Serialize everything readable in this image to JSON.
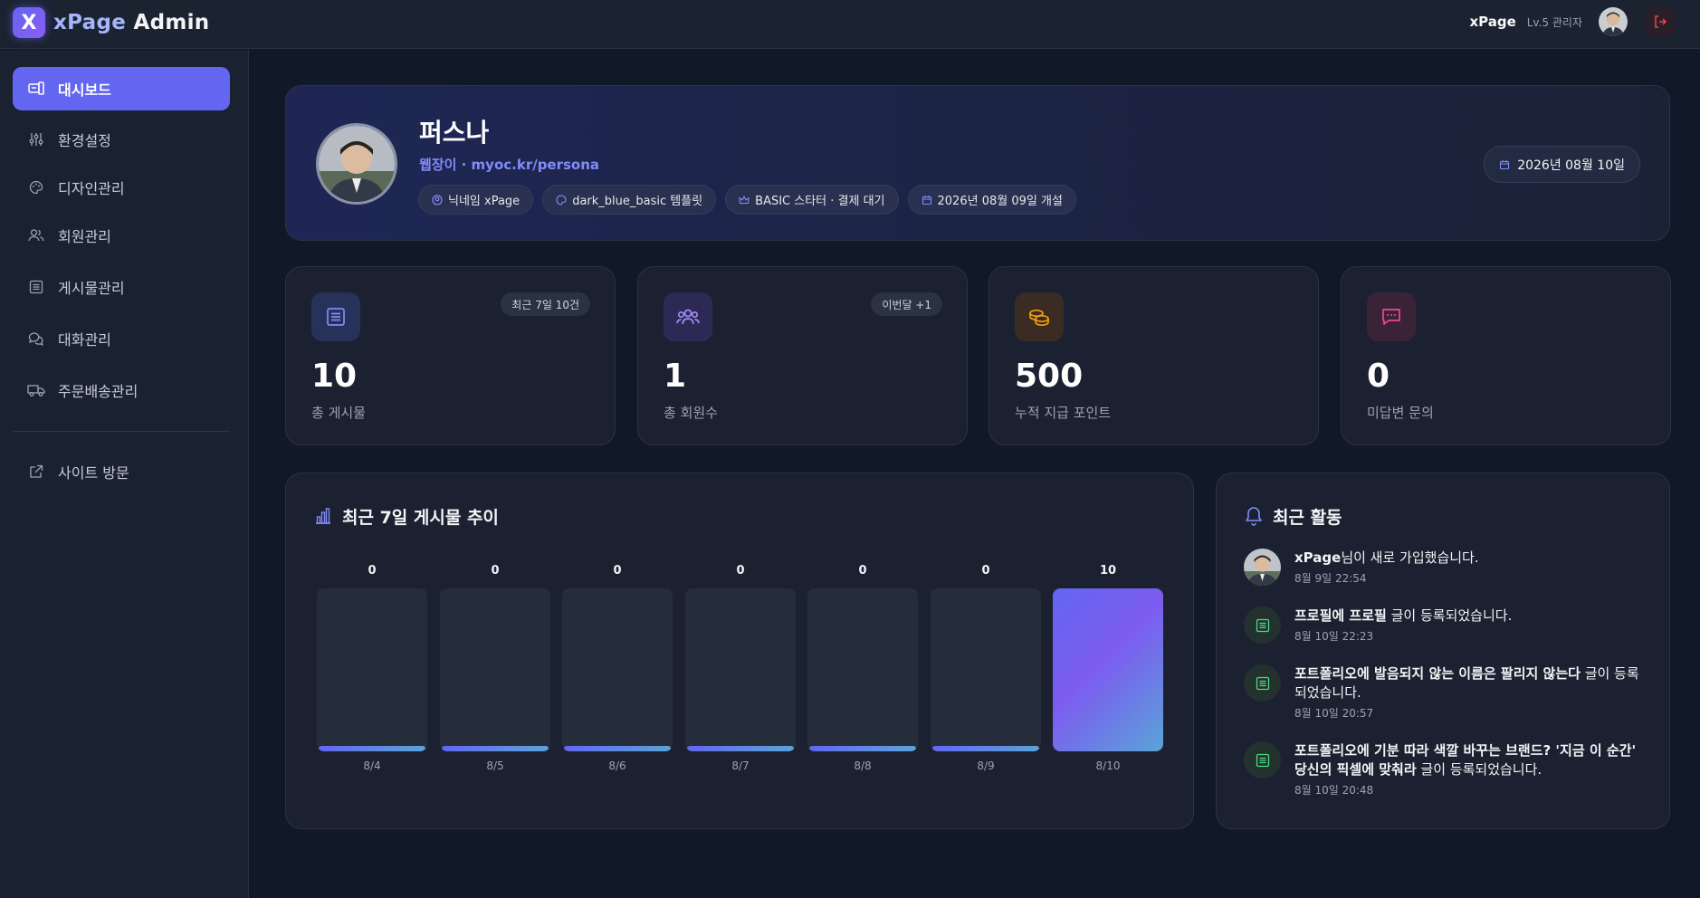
{
  "header": {
    "brand_mark": "X",
    "brand_first": "xPage",
    "brand_second": " Admin",
    "user_name": "xPage",
    "user_level": "Lv.5 관리자"
  },
  "sidebar": {
    "items": [
      {
        "label": "대시보드",
        "icon": "dashboard-icon"
      },
      {
        "label": "환경설정",
        "icon": "sliders-icon"
      },
      {
        "label": "디자인관리",
        "icon": "palette-icon"
      },
      {
        "label": "회원관리",
        "icon": "users-icon"
      },
      {
        "label": "게시물관리",
        "icon": "list-icon"
      },
      {
        "label": "대화관리",
        "icon": "chat-icon"
      },
      {
        "label": "주문배송관리",
        "icon": "truck-icon"
      }
    ],
    "visit_label": "사이트 방문"
  },
  "profile": {
    "name": "퍼스나",
    "link": "웹장이 · myoc.kr/persona",
    "chips": [
      {
        "text": "닉네임 xPage",
        "icon": "user-circle-icon"
      },
      {
        "text": "dark_blue_basic 템플릿",
        "icon": "palette-icon"
      },
      {
        "text": "BASIC 스타터 · 결제 대기",
        "icon": "crown-icon"
      },
      {
        "text": "2026년 08월 09일 개설",
        "icon": "calendar-icon"
      }
    ],
    "date": "2026년 08월 10일"
  },
  "stats": [
    {
      "value": "10",
      "label": "총 게시물",
      "badge": "최근 7일 10건",
      "icon": "document-icon",
      "color": "#818cf8"
    },
    {
      "value": "1",
      "label": "총 회원수",
      "badge": "이번달 +1",
      "icon": "users-icon",
      "color": "#a78bfa"
    },
    {
      "value": "500",
      "label": "누적 지급 포인트",
      "badge": "",
      "icon": "coins-icon",
      "color": "#f59e0b"
    },
    {
      "value": "0",
      "label": "미답변 문의",
      "badge": "",
      "icon": "message-icon",
      "color": "#ec4899"
    }
  ],
  "chart_data": {
    "type": "bar",
    "title": "최근 7일 게시물 추이",
    "categories": [
      "8/4",
      "8/5",
      "8/6",
      "8/7",
      "8/8",
      "8/9",
      "8/10"
    ],
    "values": [
      0,
      0,
      0,
      0,
      0,
      0,
      10
    ],
    "ylim": [
      0,
      10
    ]
  },
  "activity": {
    "title": "최근 활동",
    "items": [
      {
        "bold": "xPage",
        "text": "님이 새로 가입했습니다.",
        "time": "8월 9일 22:54",
        "type": "avatar"
      },
      {
        "bold": "프로필에 프로필",
        "text": " 글이 등록되었습니다.",
        "time": "8월 10일 22:23",
        "type": "doc"
      },
      {
        "bold": "포트폴리오에 발음되지 않는 이름은 팔리지 않는다",
        "text": " 글이 등록되었습니다.",
        "time": "8월 10일 20:57",
        "type": "doc"
      },
      {
        "bold": "포트폴리오에 기분 따라 색깔 바꾸는 브랜드? '지금 이 순간' 당신의 픽셀에 맞춰라",
        "text": " 글이 등록되었습니다.",
        "time": "8월 10일 20:48",
        "type": "doc"
      }
    ]
  }
}
